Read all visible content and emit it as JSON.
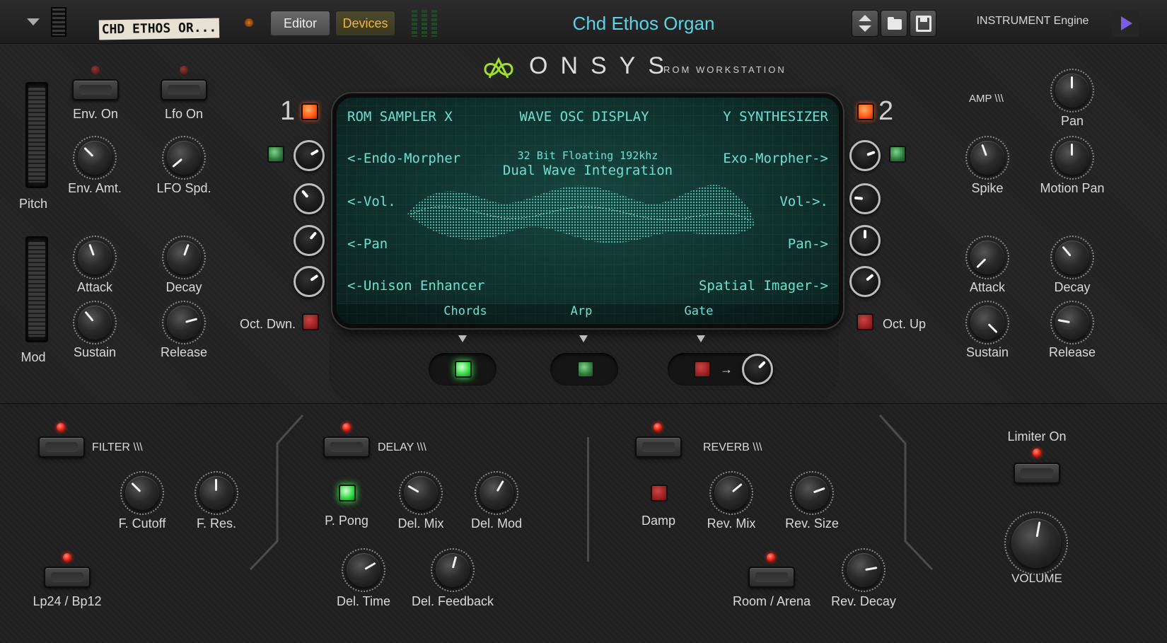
{
  "topbar": {
    "patch_tape": "CHD ETHOS OR...",
    "editor_label": "Editor",
    "devices_label": "Devices",
    "patch_name": "Chd Ethos Organ",
    "engine_label": "INSTRUMENT Engine",
    "patch_color": "#5bd4e6",
    "devices_color": "#f3b43a"
  },
  "brand": {
    "name": "ONSYS",
    "subtitle": "ROM WORKSTATION"
  },
  "left": {
    "pitch": "Pitch",
    "mod": "Mod",
    "env_on": "Env. On",
    "lfo_on": "Lfo On",
    "env_amt": "Env. Amt.",
    "lfo_spd": "LFO Spd.",
    "attack": "Attack",
    "decay": "Decay",
    "sustain": "Sustain",
    "release": "Release"
  },
  "slots": {
    "slot1": "1",
    "slot2": "2",
    "oct_down": "Oct. Dwn.",
    "oct_up": "Oct. Up"
  },
  "display": {
    "left_title": "ROM SAMPLER X",
    "center_title": "WAVE OSC DISPLAY",
    "right_title": "Y SYNTHESIZER",
    "spec_line1": "32 Bit Floating 192khz",
    "spec_line2": "Dual Wave Integration",
    "l_endo": "<-Endo-Morpher",
    "l_vol": "<-Vol.",
    "l_pan": "<-Pan",
    "l_unison": "<-Unison Enhancer",
    "r_exo": "Exo-Morpher->",
    "r_vol": "Vol->.",
    "r_pan": "Pan->",
    "r_spatial": "Spatial Imager->",
    "tab_chords": "Chords",
    "tab_arp": "Arp",
    "tab_gate": "Gate",
    "screen_color": "#6fe0cf"
  },
  "amp": {
    "title": "AMP \\\\\\",
    "pan": "Pan",
    "spike": "Spike",
    "motion_pan": "Motion Pan",
    "attack": "Attack",
    "decay": "Decay",
    "sustain": "Sustain",
    "release": "Release"
  },
  "filter": {
    "title": "FILTER \\\\\\",
    "cutoff": "F. Cutoff",
    "res": "F. Res.",
    "mode": "Lp24 / Bp12"
  },
  "delay": {
    "title": "DELAY \\\\\\",
    "ppong": "P. Pong",
    "mix": "Del. Mix",
    "mod": "Del. Mod",
    "time": "Del. Time",
    "feedback": "Del. Feedback"
  },
  "reverb": {
    "title": "REVERB \\\\\\",
    "damp": "Damp",
    "mix": "Rev. Mix",
    "size": "Rev. Size",
    "room": "Room / Arena",
    "decay": "Rev. Decay"
  },
  "master": {
    "limiter": "Limiter On",
    "volume": "VOLUME"
  },
  "accent": "#9fe02a"
}
